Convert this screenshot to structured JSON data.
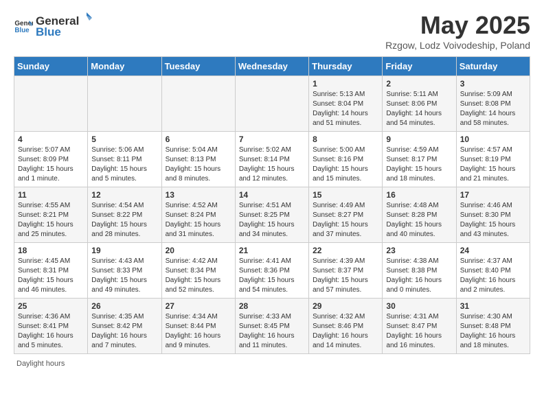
{
  "header": {
    "logo_general": "General",
    "logo_blue": "Blue",
    "title": "May 2025",
    "subtitle": "Rzgow, Lodz Voivodeship, Poland"
  },
  "calendar": {
    "days_of_week": [
      "Sunday",
      "Monday",
      "Tuesday",
      "Wednesday",
      "Thursday",
      "Friday",
      "Saturday"
    ],
    "weeks": [
      [
        {
          "day": "",
          "info": ""
        },
        {
          "day": "",
          "info": ""
        },
        {
          "day": "",
          "info": ""
        },
        {
          "day": "",
          "info": ""
        },
        {
          "day": "1",
          "info": "Sunrise: 5:13 AM\nSunset: 8:04 PM\nDaylight: 14 hours and 51 minutes."
        },
        {
          "day": "2",
          "info": "Sunrise: 5:11 AM\nSunset: 8:06 PM\nDaylight: 14 hours and 54 minutes."
        },
        {
          "day": "3",
          "info": "Sunrise: 5:09 AM\nSunset: 8:08 PM\nDaylight: 14 hours and 58 minutes."
        }
      ],
      [
        {
          "day": "4",
          "info": "Sunrise: 5:07 AM\nSunset: 8:09 PM\nDaylight: 15 hours and 1 minute."
        },
        {
          "day": "5",
          "info": "Sunrise: 5:06 AM\nSunset: 8:11 PM\nDaylight: 15 hours and 5 minutes."
        },
        {
          "day": "6",
          "info": "Sunrise: 5:04 AM\nSunset: 8:13 PM\nDaylight: 15 hours and 8 minutes."
        },
        {
          "day": "7",
          "info": "Sunrise: 5:02 AM\nSunset: 8:14 PM\nDaylight: 15 hours and 12 minutes."
        },
        {
          "day": "8",
          "info": "Sunrise: 5:00 AM\nSunset: 8:16 PM\nDaylight: 15 hours and 15 minutes."
        },
        {
          "day": "9",
          "info": "Sunrise: 4:59 AM\nSunset: 8:17 PM\nDaylight: 15 hours and 18 minutes."
        },
        {
          "day": "10",
          "info": "Sunrise: 4:57 AM\nSunset: 8:19 PM\nDaylight: 15 hours and 21 minutes."
        }
      ],
      [
        {
          "day": "11",
          "info": "Sunrise: 4:55 AM\nSunset: 8:21 PM\nDaylight: 15 hours and 25 minutes."
        },
        {
          "day": "12",
          "info": "Sunrise: 4:54 AM\nSunset: 8:22 PM\nDaylight: 15 hours and 28 minutes."
        },
        {
          "day": "13",
          "info": "Sunrise: 4:52 AM\nSunset: 8:24 PM\nDaylight: 15 hours and 31 minutes."
        },
        {
          "day": "14",
          "info": "Sunrise: 4:51 AM\nSunset: 8:25 PM\nDaylight: 15 hours and 34 minutes."
        },
        {
          "day": "15",
          "info": "Sunrise: 4:49 AM\nSunset: 8:27 PM\nDaylight: 15 hours and 37 minutes."
        },
        {
          "day": "16",
          "info": "Sunrise: 4:48 AM\nSunset: 8:28 PM\nDaylight: 15 hours and 40 minutes."
        },
        {
          "day": "17",
          "info": "Sunrise: 4:46 AM\nSunset: 8:30 PM\nDaylight: 15 hours and 43 minutes."
        }
      ],
      [
        {
          "day": "18",
          "info": "Sunrise: 4:45 AM\nSunset: 8:31 PM\nDaylight: 15 hours and 46 minutes."
        },
        {
          "day": "19",
          "info": "Sunrise: 4:43 AM\nSunset: 8:33 PM\nDaylight: 15 hours and 49 minutes."
        },
        {
          "day": "20",
          "info": "Sunrise: 4:42 AM\nSunset: 8:34 PM\nDaylight: 15 hours and 52 minutes."
        },
        {
          "day": "21",
          "info": "Sunrise: 4:41 AM\nSunset: 8:36 PM\nDaylight: 15 hours and 54 minutes."
        },
        {
          "day": "22",
          "info": "Sunrise: 4:39 AM\nSunset: 8:37 PM\nDaylight: 15 hours and 57 minutes."
        },
        {
          "day": "23",
          "info": "Sunrise: 4:38 AM\nSunset: 8:38 PM\nDaylight: 16 hours and 0 minutes."
        },
        {
          "day": "24",
          "info": "Sunrise: 4:37 AM\nSunset: 8:40 PM\nDaylight: 16 hours and 2 minutes."
        }
      ],
      [
        {
          "day": "25",
          "info": "Sunrise: 4:36 AM\nSunset: 8:41 PM\nDaylight: 16 hours and 5 minutes."
        },
        {
          "day": "26",
          "info": "Sunrise: 4:35 AM\nSunset: 8:42 PM\nDaylight: 16 hours and 7 minutes."
        },
        {
          "day": "27",
          "info": "Sunrise: 4:34 AM\nSunset: 8:44 PM\nDaylight: 16 hours and 9 minutes."
        },
        {
          "day": "28",
          "info": "Sunrise: 4:33 AM\nSunset: 8:45 PM\nDaylight: 16 hours and 11 minutes."
        },
        {
          "day": "29",
          "info": "Sunrise: 4:32 AM\nSunset: 8:46 PM\nDaylight: 16 hours and 14 minutes."
        },
        {
          "day": "30",
          "info": "Sunrise: 4:31 AM\nSunset: 8:47 PM\nDaylight: 16 hours and 16 minutes."
        },
        {
          "day": "31",
          "info": "Sunrise: 4:30 AM\nSunset: 8:48 PM\nDaylight: 16 hours and 18 minutes."
        }
      ]
    ]
  },
  "footer": {
    "text": "Daylight hours"
  }
}
